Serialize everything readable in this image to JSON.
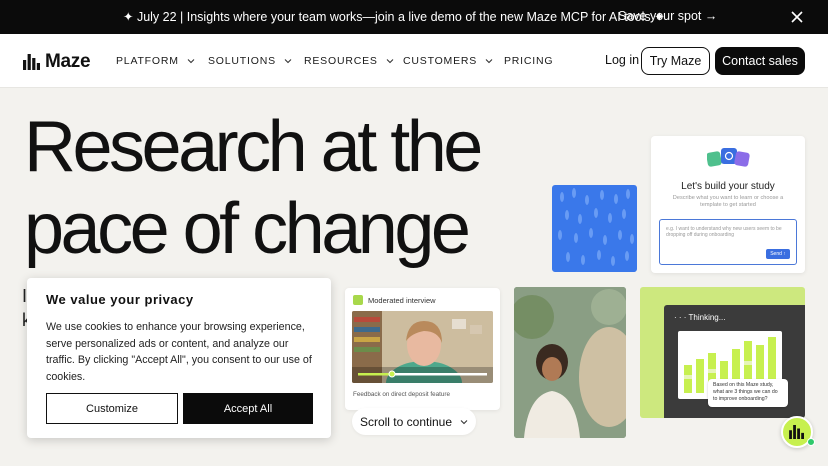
{
  "announcement": {
    "message": "✦ July 22 | Insights where your team works—join a live demo of the new Maze MCP for AI tools ✦",
    "cta": "Save your spot →"
  },
  "nav": {
    "brand": "Maze",
    "items": [
      {
        "label": "PLATFORM",
        "has_dropdown": true
      },
      {
        "label": "SOLUTIONS",
        "has_dropdown": true
      },
      {
        "label": "RESOURCES",
        "has_dropdown": true
      },
      {
        "label": "CUSTOMERS",
        "has_dropdown": true
      },
      {
        "label": "PRICING",
        "has_dropdown": false
      }
    ],
    "login": "Log in",
    "try": "Try Maze",
    "contact": "Contact sales"
  },
  "hero": {
    "line1": "Research at the",
    "line2": "pace of change",
    "peek1": "I",
    "peek2": "k"
  },
  "cookie": {
    "title": "We value your privacy",
    "body": "We use cookies to enhance your browsing experience, serve personalized ads or content, and analyze our traffic. By clicking \"Accept All\", you consent to our use of cookies.",
    "customize": "Customize",
    "accept": "Accept All"
  },
  "study_card": {
    "title": "Let's build your study",
    "subtitle": "Describe what you want to learn or choose a template to get started",
    "placeholder": "e.g. I want to understand why new users seem to be dropping off during onboarding",
    "send": "Send ↑"
  },
  "interview_card": {
    "label": "Moderated interview",
    "caption": "Feedback on direct deposit feature"
  },
  "scroll": {
    "label": "Scroll to continue"
  },
  "thinking_card": {
    "title": "· · ·  Thinking...",
    "prompt": "Based on this Maze study, what are 3 things we can do to improve onboarding?"
  },
  "colors": {
    "accent_lime": "#c7f04f",
    "blue_card": "#3a78ea",
    "dark": "#0b0b0b",
    "background": "#f3f2ee"
  }
}
